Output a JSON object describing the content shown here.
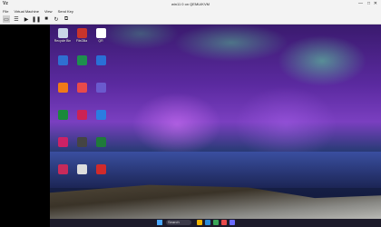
{
  "window": {
    "app_icon": "Vz",
    "title": "win11 0 on QEMU/KVM",
    "minimize": "—",
    "maximize": "□",
    "close": "✕"
  },
  "menu": [
    "File",
    "Virtual Machine",
    "View",
    "Send Key"
  ],
  "toolbar": {
    "display_icon": "monitor-icon",
    "info_icon": "info-icon",
    "run_icon": "play-icon",
    "pause_icon": "pause-icon",
    "stop_icon": "stop-icon",
    "snapshot_icon": "snapshot-icon"
  },
  "desktop_icons": [
    {
      "label": "Recycle Bin",
      "color": "#c9d6e8"
    },
    {
      "label": "FileZilla",
      "color": "#c8342b"
    },
    {
      "label": "QR",
      "color": "#ffffff"
    },
    {
      "label": "",
      "color": "#2f6fd1"
    },
    {
      "label": "",
      "color": "#1e8f4e"
    },
    {
      "label": "",
      "color": "#2a6fd6"
    },
    {
      "label": "",
      "color": "#f07a17"
    },
    {
      "label": "",
      "color": "#e84a4a"
    },
    {
      "label": "",
      "color": "#6a5acd"
    },
    {
      "label": "",
      "color": "#1a8a3a"
    },
    {
      "label": "",
      "color": "#cc2255"
    },
    {
      "label": "",
      "color": "#2a7de1"
    },
    {
      "label": "",
      "color": "#cc2266"
    },
    {
      "label": "",
      "color": "#444444"
    },
    {
      "label": "",
      "color": "#1f7a3a"
    },
    {
      "label": "",
      "color": "#c82a5a"
    },
    {
      "label": "",
      "color": "#dddddd"
    },
    {
      "label": "",
      "color": "#d12a2a"
    }
  ],
  "taskbar": {
    "search_placeholder": "Search",
    "time": "",
    "date": ""
  }
}
